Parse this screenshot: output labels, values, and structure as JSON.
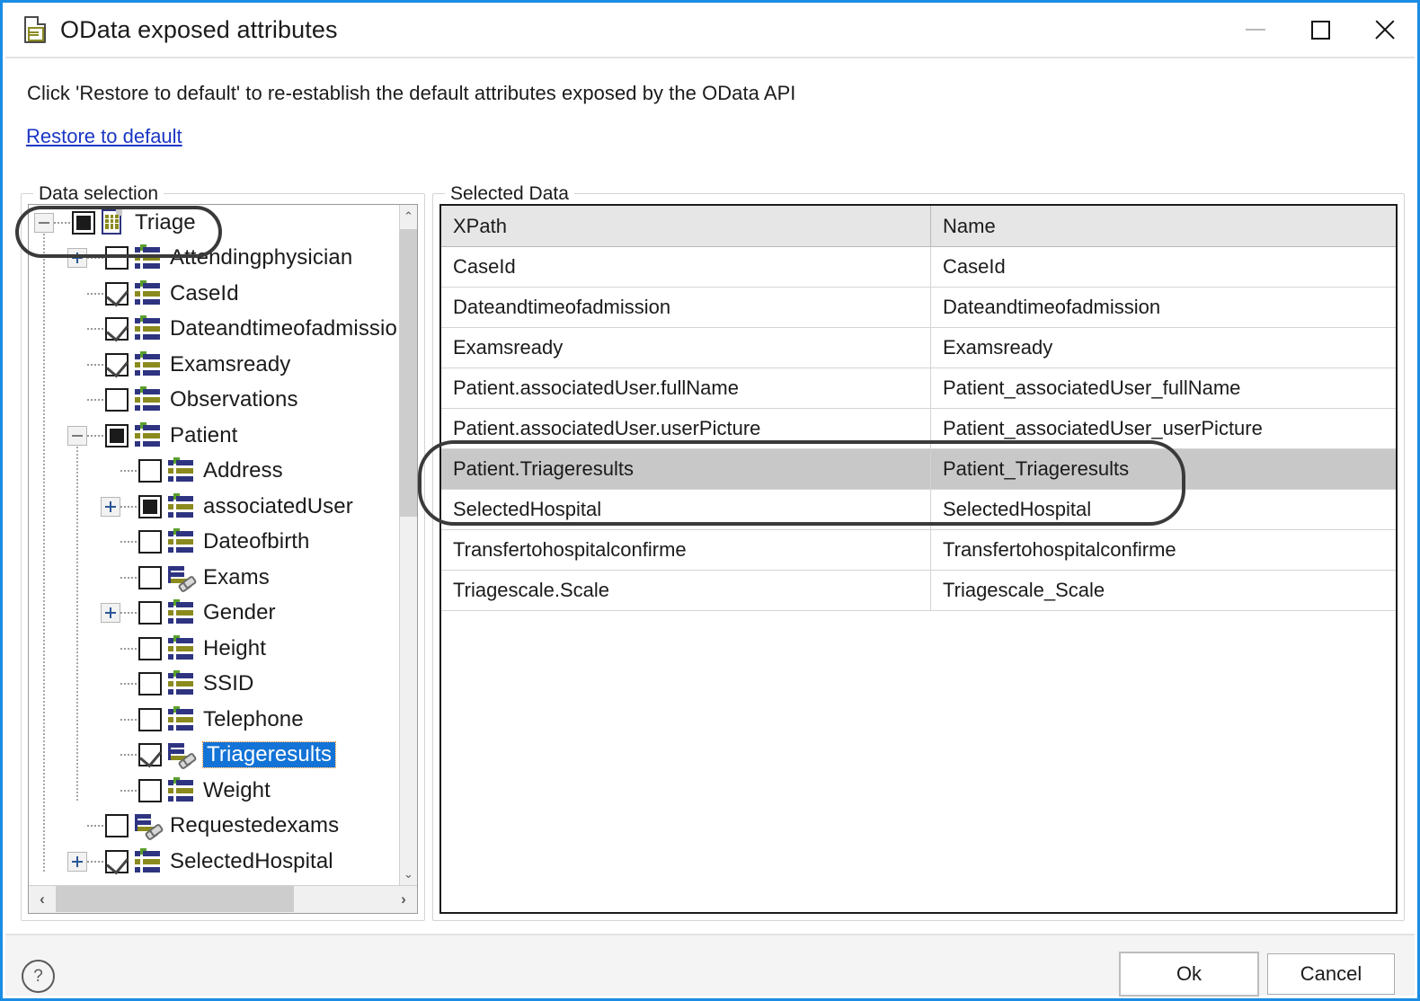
{
  "window": {
    "title": "OData exposed attributes",
    "icon": "document-table-icon",
    "minimize_label": "–",
    "maximize_label": "□",
    "close_label": "✕"
  },
  "instruction": "Click 'Restore to default' to re-establish the default attributes exposed by the OData API",
  "restore_link": "Restore to default",
  "data_selection": {
    "group_label": "Data selection",
    "tree": [
      {
        "label": "Triage",
        "depth": 0,
        "check": "filled",
        "icon": "root",
        "twisty": "minus",
        "selected": false
      },
      {
        "label": "Attendingphysician",
        "depth": 1,
        "check": "unchecked",
        "icon": "attr",
        "twisty": "plus",
        "selected": false
      },
      {
        "label": "CaseId",
        "depth": 1,
        "check": "checked",
        "icon": "attr",
        "twisty": "none",
        "selected": false
      },
      {
        "label": "Dateandtimeofadmissio",
        "depth": 1,
        "check": "checked",
        "icon": "attr",
        "twisty": "none",
        "selected": false
      },
      {
        "label": "Examsready",
        "depth": 1,
        "check": "checked",
        "icon": "attr",
        "twisty": "none",
        "selected": false
      },
      {
        "label": "Observations",
        "depth": 1,
        "check": "unchecked",
        "icon": "attr",
        "twisty": "none",
        "selected": false
      },
      {
        "label": "Patient",
        "depth": 1,
        "check": "filled",
        "icon": "attr",
        "twisty": "minus",
        "selected": false
      },
      {
        "label": "Address",
        "depth": 2,
        "check": "unchecked",
        "icon": "attr",
        "twisty": "none",
        "selected": false
      },
      {
        "label": "associatedUser",
        "depth": 2,
        "check": "filled",
        "icon": "attr",
        "twisty": "plus",
        "selected": false
      },
      {
        "label": "Dateofbirth",
        "depth": 2,
        "check": "unchecked",
        "icon": "attr",
        "twisty": "none",
        "selected": false
      },
      {
        "label": "Exams",
        "depth": 2,
        "check": "unchecked",
        "icon": "assoc",
        "twisty": "none",
        "selected": false
      },
      {
        "label": "Gender",
        "depth": 2,
        "check": "unchecked",
        "icon": "attr",
        "twisty": "plus",
        "selected": false
      },
      {
        "label": "Height",
        "depth": 2,
        "check": "unchecked",
        "icon": "attr",
        "twisty": "none",
        "selected": false
      },
      {
        "label": "SSID",
        "depth": 2,
        "check": "unchecked",
        "icon": "attr",
        "twisty": "none",
        "selected": false
      },
      {
        "label": "Telephone",
        "depth": 2,
        "check": "unchecked",
        "icon": "attr",
        "twisty": "none",
        "selected": false
      },
      {
        "label": "Triageresults",
        "depth": 2,
        "check": "checked",
        "icon": "assoc",
        "twisty": "none",
        "selected": true
      },
      {
        "label": "Weight",
        "depth": 2,
        "check": "unchecked",
        "icon": "attr",
        "twisty": "none",
        "selected": false
      },
      {
        "label": "Requestedexams",
        "depth": 1,
        "check": "unchecked",
        "icon": "assoc",
        "twisty": "none",
        "selected": false
      },
      {
        "label": "SelectedHospital",
        "depth": 1,
        "check": "checked",
        "icon": "attr",
        "twisty": "plus",
        "selected": false
      }
    ],
    "scroll_up_glyph": "⌃",
    "scroll_down_glyph": "⌄",
    "scroll_left_glyph": "‹",
    "scroll_right_glyph": "›"
  },
  "selected_data": {
    "group_label": "Selected Data",
    "columns": [
      "XPath",
      "Name"
    ],
    "rows": [
      {
        "xpath": "CaseId",
        "name": "CaseId",
        "highlighted": false
      },
      {
        "xpath": "Dateandtimeofadmission",
        "name": "Dateandtimeofadmission",
        "highlighted": false
      },
      {
        "xpath": "Examsready",
        "name": "Examsready",
        "highlighted": false
      },
      {
        "xpath": "Patient.associatedUser.fullName",
        "name": "Patient_associatedUser_fullName",
        "highlighted": false
      },
      {
        "xpath": "Patient.associatedUser.userPicture",
        "name": "Patient_associatedUser_userPicture",
        "highlighted": false
      },
      {
        "xpath": "Patient.Triageresults",
        "name": "Patient_Triageresults",
        "highlighted": true
      },
      {
        "xpath": "SelectedHospital",
        "name": "SelectedHospital",
        "highlighted": false
      },
      {
        "xpath": "Transfertohospitalconfirme",
        "name": "Transfertohospitalconfirme",
        "highlighted": false
      },
      {
        "xpath": "Triagescale.Scale",
        "name": "Triagescale_Scale",
        "highlighted": false
      }
    ]
  },
  "footer": {
    "help_glyph": "?",
    "ok_label": "Ok",
    "cancel_label": "Cancel"
  },
  "colors": {
    "window_border": "#1b8ce3",
    "link": "#1b36c4",
    "selection": "#1373d6",
    "row_highlight": "#c8c8c8",
    "annotation": "#3a3a3a"
  }
}
